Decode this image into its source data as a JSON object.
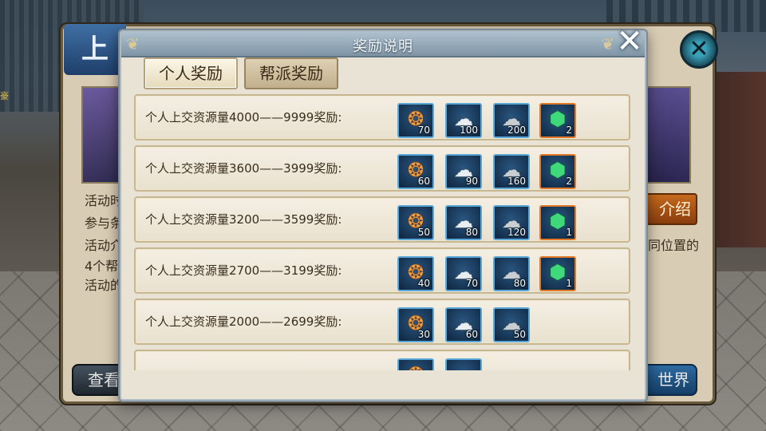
{
  "background_panel": {
    "title_char": "上",
    "side_tag": "豪",
    "text_lines": [
      "活动时",
      "参与条",
      "活动介",
      "4个帮",
      "活动的"
    ],
    "right_text": "同位置的",
    "intro_button_label": "介绍",
    "view_button_label": "查看",
    "world_button_label": "世界",
    "close_icon": "close-icon"
  },
  "dialog": {
    "title": "奖励说明",
    "tabs": [
      {
        "label": "个人奖励",
        "active": true
      },
      {
        "label": "帮派奖励",
        "active": false
      }
    ],
    "rows": [
      {
        "label": "个人上交资源量4000——9999奖励:",
        "items": [
          {
            "icon": "amber-orb-icon",
            "qty": "70",
            "border": "blue"
          },
          {
            "icon": "silver-cloud-icon",
            "qty": "100",
            "border": "blue"
          },
          {
            "icon": "ore-stone-icon",
            "qty": "200",
            "border": "blue"
          },
          {
            "icon": "green-gem-icon",
            "qty": "2",
            "border": "orange"
          }
        ]
      },
      {
        "label": "个人上交资源量3600——3999奖励:",
        "items": [
          {
            "icon": "amber-orb-icon",
            "qty": "60",
            "border": "blue"
          },
          {
            "icon": "silver-cloud-icon",
            "qty": "90",
            "border": "blue"
          },
          {
            "icon": "ore-stone-icon",
            "qty": "160",
            "border": "blue"
          },
          {
            "icon": "green-gem-icon",
            "qty": "2",
            "border": "orange"
          }
        ]
      },
      {
        "label": "个人上交资源量3200——3599奖励:",
        "items": [
          {
            "icon": "amber-orb-icon",
            "qty": "50",
            "border": "blue"
          },
          {
            "icon": "silver-cloud-icon",
            "qty": "80",
            "border": "blue"
          },
          {
            "icon": "ore-stone-icon",
            "qty": "120",
            "border": "blue"
          },
          {
            "icon": "green-gem-icon",
            "qty": "1",
            "border": "orange"
          }
        ]
      },
      {
        "label": "个人上交资源量2700——3199奖励:",
        "items": [
          {
            "icon": "amber-orb-icon",
            "qty": "40",
            "border": "blue"
          },
          {
            "icon": "silver-cloud-icon",
            "qty": "70",
            "border": "blue"
          },
          {
            "icon": "ore-stone-icon",
            "qty": "80",
            "border": "blue"
          },
          {
            "icon": "green-gem-icon",
            "qty": "1",
            "border": "orange"
          }
        ]
      },
      {
        "label": "个人上交资源量2000——2699奖励:",
        "items": [
          {
            "icon": "amber-orb-icon",
            "qty": "30",
            "border": "blue"
          },
          {
            "icon": "silver-cloud-icon",
            "qty": "60",
            "border": "blue"
          },
          {
            "icon": "ore-stone-icon",
            "qty": "50",
            "border": "blue"
          }
        ]
      },
      {
        "label": "",
        "items": [
          {
            "icon": "amber-orb-icon",
            "qty": "",
            "border": "blue"
          },
          {
            "icon": "silver-cloud-icon",
            "qty": "",
            "border": "blue"
          }
        ]
      }
    ]
  },
  "colors": {
    "dialog_bg": "#e9e3d6",
    "header": "#8ea3b3",
    "blue_border": "#5aa8d8",
    "orange_border": "#e0792a"
  }
}
